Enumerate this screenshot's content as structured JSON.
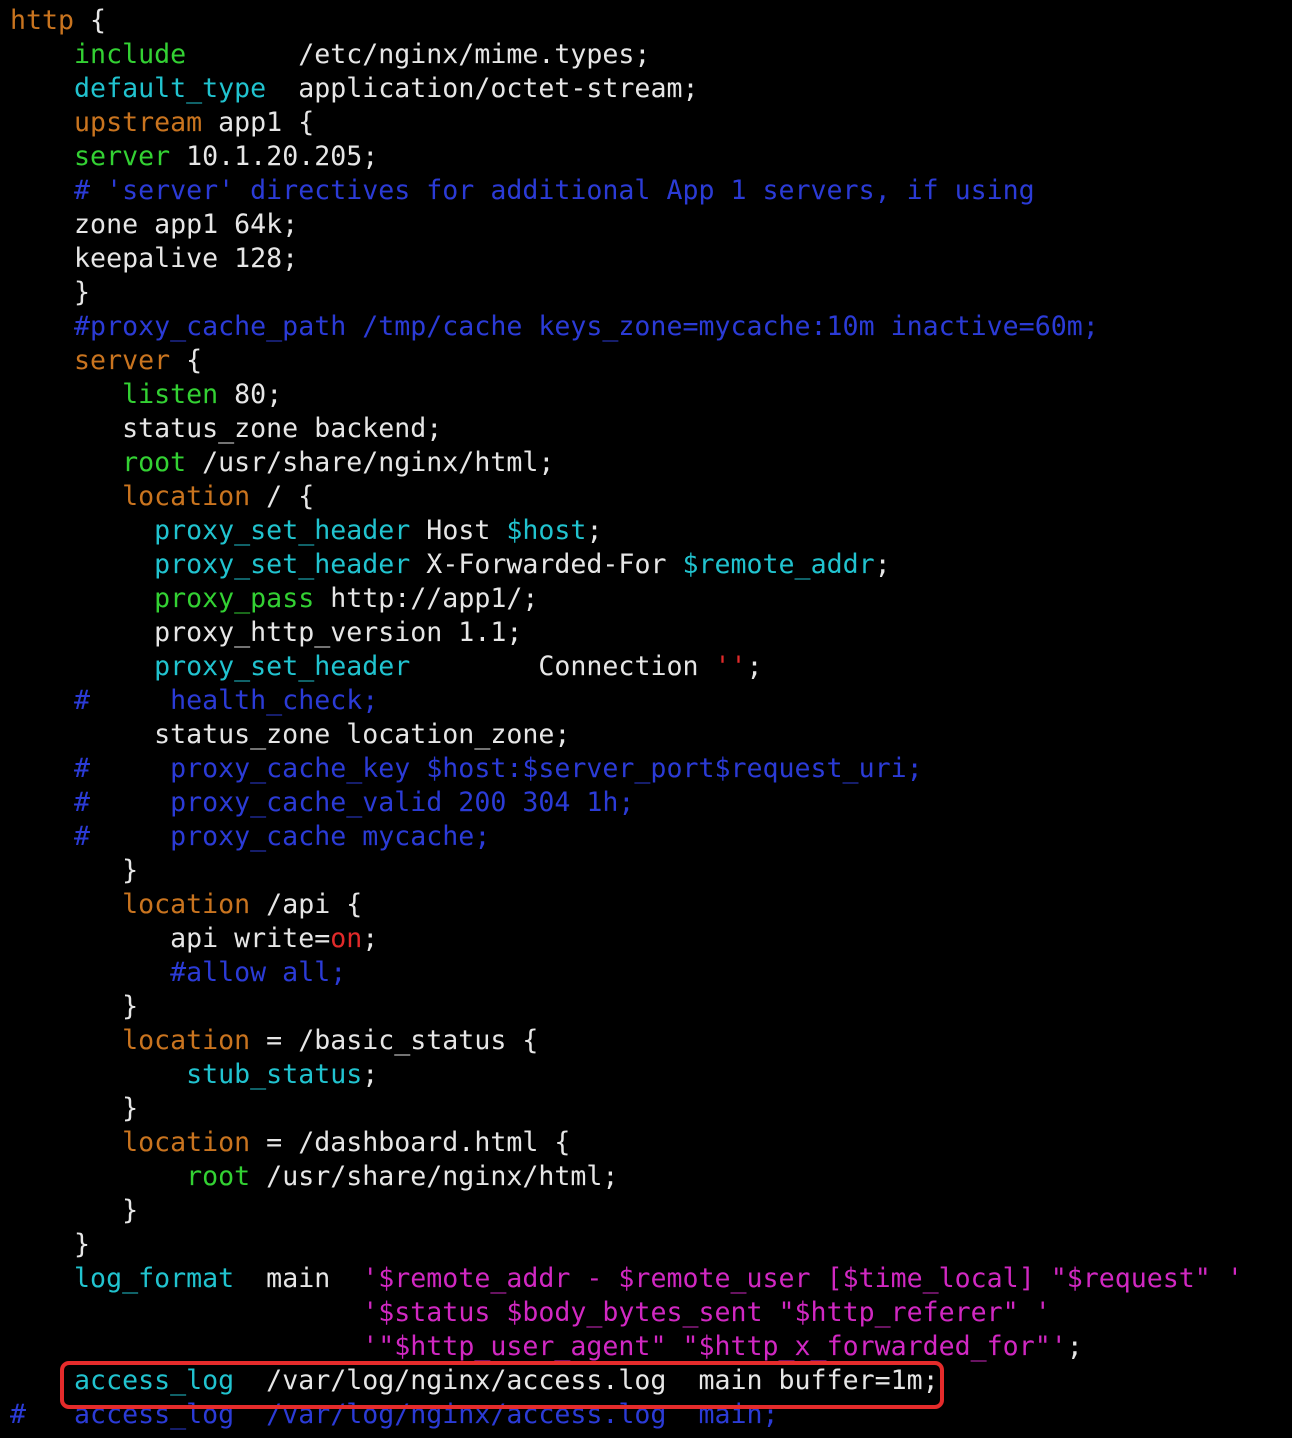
{
  "colors": {
    "background": "#000000",
    "keyword_brown": "#c9741f",
    "directive_green": "#33d133",
    "directive_cyan": "#21c3cf",
    "comment_blue": "#2b3bd6",
    "string_magenta": "#d128c2",
    "value_red": "#e22a2a",
    "text_white": "#e6e6e6",
    "highlight_border": "#e52b2b"
  },
  "code": {
    "lines": [
      [
        {
          "t": "http",
          "c": "brown"
        },
        {
          "t": " {",
          "c": "white"
        }
      ],
      [
        {
          "t": "    ",
          "c": "white"
        },
        {
          "t": "include",
          "c": "green"
        },
        {
          "t": "       /etc/nginx/mime.types;",
          "c": "white"
        }
      ],
      [
        {
          "t": "    ",
          "c": "white"
        },
        {
          "t": "default_type",
          "c": "cyan"
        },
        {
          "t": "  application/octet-stream;",
          "c": "white"
        }
      ],
      [
        {
          "t": "    ",
          "c": "white"
        },
        {
          "t": "upstream",
          "c": "brown"
        },
        {
          "t": " app1 {",
          "c": "white"
        }
      ],
      [
        {
          "t": "    ",
          "c": "white"
        },
        {
          "t": "server",
          "c": "green"
        },
        {
          "t": " 10.1.20.205;",
          "c": "white"
        }
      ],
      [
        {
          "t": "    # 'server' directives for additional App 1 servers, if using",
          "c": "blue"
        }
      ],
      [
        {
          "t": "    zone app1 64k;",
          "c": "white"
        }
      ],
      [
        {
          "t": "    keepalive 128;",
          "c": "white"
        }
      ],
      [
        {
          "t": "    }",
          "c": "white"
        }
      ],
      [
        {
          "t": "    #proxy_cache_path /tmp/cache keys_zone=mycache:10m inactive=60m;",
          "c": "blue"
        }
      ],
      [
        {
          "t": "    ",
          "c": "white"
        },
        {
          "t": "server",
          "c": "brown"
        },
        {
          "t": " {",
          "c": "white"
        }
      ],
      [
        {
          "t": "       ",
          "c": "white"
        },
        {
          "t": "listen",
          "c": "green"
        },
        {
          "t": " 80;",
          "c": "white"
        }
      ],
      [
        {
          "t": "       status_zone backend;",
          "c": "white"
        }
      ],
      [
        {
          "t": "       ",
          "c": "white"
        },
        {
          "t": "root",
          "c": "green"
        },
        {
          "t": " /usr/share/nginx/html;",
          "c": "white"
        }
      ],
      [
        {
          "t": "       ",
          "c": "white"
        },
        {
          "t": "location",
          "c": "brown"
        },
        {
          "t": " / {",
          "c": "white"
        }
      ],
      [
        {
          "t": "         ",
          "c": "white"
        },
        {
          "t": "proxy_set_header",
          "c": "cyan"
        },
        {
          "t": " Host ",
          "c": "white"
        },
        {
          "t": "$host",
          "c": "cyan"
        },
        {
          "t": ";",
          "c": "white"
        }
      ],
      [
        {
          "t": "         ",
          "c": "white"
        },
        {
          "t": "proxy_set_header",
          "c": "cyan"
        },
        {
          "t": " X-Forwarded-For ",
          "c": "white"
        },
        {
          "t": "$remote_addr",
          "c": "cyan"
        },
        {
          "t": ";",
          "c": "white"
        }
      ],
      [
        {
          "t": "         ",
          "c": "white"
        },
        {
          "t": "proxy_pass",
          "c": "green"
        },
        {
          "t": " http://app1/;",
          "c": "white"
        }
      ],
      [
        {
          "t": "         proxy_http_version 1.1;",
          "c": "white"
        }
      ],
      [
        {
          "t": "         ",
          "c": "white"
        },
        {
          "t": "proxy_set_header",
          "c": "cyan"
        },
        {
          "t": "        Connection ",
          "c": "white"
        },
        {
          "t": "''",
          "c": "red"
        },
        {
          "t": ";",
          "c": "white"
        }
      ],
      [
        {
          "t": "    #     health_check;",
          "c": "blue"
        }
      ],
      [
        {
          "t": "         status_zone location_zone;",
          "c": "white"
        }
      ],
      [
        {
          "t": "    #     proxy_cache_key $host:$server_port$request_uri;",
          "c": "blue"
        }
      ],
      [
        {
          "t": "    #     proxy_cache_valid 200 304 1h;",
          "c": "blue"
        }
      ],
      [
        {
          "t": "    #     proxy_cache mycache;",
          "c": "blue"
        }
      ],
      [
        {
          "t": "       }",
          "c": "white"
        }
      ],
      [
        {
          "t": "       ",
          "c": "white"
        },
        {
          "t": "location",
          "c": "brown"
        },
        {
          "t": " /api {",
          "c": "white"
        }
      ],
      [
        {
          "t": "          api write=",
          "c": "white"
        },
        {
          "t": "on",
          "c": "red"
        },
        {
          "t": ";",
          "c": "white"
        }
      ],
      [
        {
          "t": "          #allow all;",
          "c": "blue"
        }
      ],
      [
        {
          "t": "       }",
          "c": "white"
        }
      ],
      [
        {
          "t": "       ",
          "c": "white"
        },
        {
          "t": "location",
          "c": "brown"
        },
        {
          "t": " = /basic_status {",
          "c": "white"
        }
      ],
      [
        {
          "t": "           ",
          "c": "white"
        },
        {
          "t": "stub_status",
          "c": "cyan"
        },
        {
          "t": ";",
          "c": "white"
        }
      ],
      [
        {
          "t": "       }",
          "c": "white"
        }
      ],
      [
        {
          "t": "       ",
          "c": "white"
        },
        {
          "t": "location",
          "c": "brown"
        },
        {
          "t": " = /dashboard.html {",
          "c": "white"
        }
      ],
      [
        {
          "t": "           ",
          "c": "white"
        },
        {
          "t": "root",
          "c": "green"
        },
        {
          "t": " /usr/share/nginx/html;",
          "c": "white"
        }
      ],
      [
        {
          "t": "       }",
          "c": "white"
        }
      ],
      [
        {
          "t": "    }",
          "c": "white"
        }
      ],
      [
        {
          "t": "    ",
          "c": "white"
        },
        {
          "t": "log_format",
          "c": "cyan"
        },
        {
          "t": "  main  ",
          "c": "white"
        },
        {
          "t": "'$remote_addr - $remote_user [$time_local] \"$request\" '",
          "c": "magenta"
        }
      ],
      [
        {
          "t": "                      ",
          "c": "white"
        },
        {
          "t": "'$status $body_bytes_sent \"$http_referer\" '",
          "c": "magenta"
        }
      ],
      [
        {
          "t": "                      ",
          "c": "white"
        },
        {
          "t": "'\"$http_user_agent\" \"$http_x_forwarded_for\"'",
          "c": "magenta"
        },
        {
          "t": ";",
          "c": "white"
        }
      ],
      [
        {
          "t": "    ",
          "c": "white"
        },
        {
          "t": "access_log",
          "c": "cyan"
        },
        {
          "t": "  /var/log/nginx/access.log  main buffer=1m;",
          "c": "white"
        }
      ],
      [
        {
          "t": "#   access_log  /var/log/nginx/access.log  main;",
          "c": "blue"
        }
      ]
    ]
  }
}
